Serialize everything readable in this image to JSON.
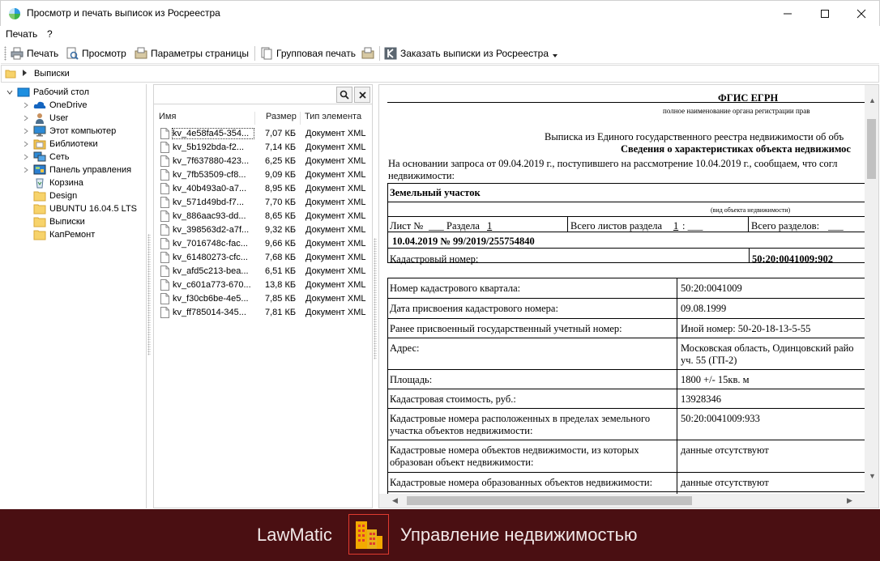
{
  "window": {
    "title": "Просмотр и печать выписок из Росреестра",
    "minimize_icon": "minimize-icon",
    "maximize_icon": "maximize-icon",
    "close_icon": "close-icon"
  },
  "menu": {
    "items": [
      "Печать",
      "?"
    ]
  },
  "toolbar": {
    "print": "Печать",
    "preview": "Просмотр",
    "page_params": "Параметры страницы",
    "group_print": "Групповая печать",
    "order": "Заказать выписки из Росреестра"
  },
  "address": {
    "path": "Выписки"
  },
  "tree": {
    "root": "Рабочий стол",
    "items": [
      "OneDrive",
      "User",
      "Этот компьютер",
      "Библиотеки",
      "Сеть",
      "Панель управления",
      "Корзина",
      "Design",
      "UBUNTU 16.04.5 LTS",
      "Выписки",
      "КапРемонт"
    ]
  },
  "files": {
    "search_placeholder": "",
    "columns": {
      "name": "Имя",
      "size": "Размер",
      "type": "Тип элемента"
    },
    "rows": [
      {
        "name": "kv_4e58fa45-354...",
        "size": "7,07 КБ",
        "type": "Документ XML"
      },
      {
        "name": "kv_5b192bda-f2...",
        "size": "7,14 КБ",
        "type": "Документ XML"
      },
      {
        "name": "kv_7f637880-423...",
        "size": "6,25 КБ",
        "type": "Документ XML"
      },
      {
        "name": "kv_7fb53509-cf8...",
        "size": "9,09 КБ",
        "type": "Документ XML"
      },
      {
        "name": "kv_40b493a0-a7...",
        "size": "8,95 КБ",
        "type": "Документ XML"
      },
      {
        "name": "kv_571d49bd-f7...",
        "size": "7,70 КБ",
        "type": "Документ XML"
      },
      {
        "name": "kv_886aac93-dd...",
        "size": "8,65 КБ",
        "type": "Документ XML"
      },
      {
        "name": "kv_398563d2-a7f...",
        "size": "9,32 КБ",
        "type": "Документ XML"
      },
      {
        "name": "kv_7016748c-fac...",
        "size": "9,66 КБ",
        "type": "Документ XML"
      },
      {
        "name": "kv_61480273-cfc...",
        "size": "7,68 КБ",
        "type": "Документ XML"
      },
      {
        "name": "kv_afd5c213-bea...",
        "size": "6,51 КБ",
        "type": "Документ XML"
      },
      {
        "name": "kv_c601a773-670...",
        "size": "13,8 КБ",
        "type": "Документ XML"
      },
      {
        "name": "kv_f30cb6be-4e5...",
        "size": "7,85 КБ",
        "type": "Документ XML"
      },
      {
        "name": "kv_ff785014-345...",
        "size": "7,81 КБ",
        "type": "Документ XML"
      }
    ]
  },
  "doc": {
    "org": "ФГИС ЕГРН",
    "org_sub": "полное наименование органа регистрации прав",
    "title1": "Выписка из Единого государственного реестра недвижимости об объ",
    "title2": "Сведения о характеристиках объекта недвижимос",
    "intro1": "На основании запроса от 09.04.2019 г., поступившего на рассмотрение 10.04.2019 г., сообщаем, что согл",
    "intro2": "недвижимости:",
    "object_type": "Земельный участок",
    "object_type_sub": "(вид объекта недвижимости)",
    "sheet_label": "Лист №",
    "section_label": "Раздела",
    "section_num": "1",
    "total_sheets": "Всего листов раздела",
    "total_sheets_num": "1",
    "total_sections": "Всего разделов:",
    "date_num": "10.04.2019   №   99/2019/255754840",
    "cad_label": "Кадастровый номер:",
    "cad_value": "50:20:0041009:902",
    "rows": [
      {
        "label": "Номер кадастрового квартала:",
        "value": "50:20:0041009"
      },
      {
        "label": "Дата присвоения кадастрового номера:",
        "value": "09.08.1999"
      },
      {
        "label": "Ранее присвоенный государственный учетный номер:",
        "value": "Иной номер: 50-20-18-13-5-55"
      },
      {
        "label": "Адрес:",
        "value": "Московская область, Одинцовский райо",
        "value2": "уч. 55 (ГП-2)"
      },
      {
        "label": "Площадь:",
        "value": "1800 +/- 15кв. м"
      },
      {
        "label": "Кадастровая стоимость, руб.:",
        "value": "13928346"
      },
      {
        "label": "Кадастровые номера расположенных в пределах земельного",
        "label2": "участка объектов недвижимости:",
        "value": "50:20:0041009:933"
      },
      {
        "label": "Кадастровые номера объектов недвижимости, из которых",
        "label2": "образован объект недвижимости:",
        "value": "данные отсутствуют"
      },
      {
        "label": "Кадастровые номера образованных объектов недвижимости:",
        "value": "данные отсутствуют"
      }
    ]
  },
  "footer": {
    "brand": "LawMatic",
    "tagline": "Управление недвижимостью",
    "bg_color": "#4a0f12",
    "accent": "#e03a2f"
  }
}
